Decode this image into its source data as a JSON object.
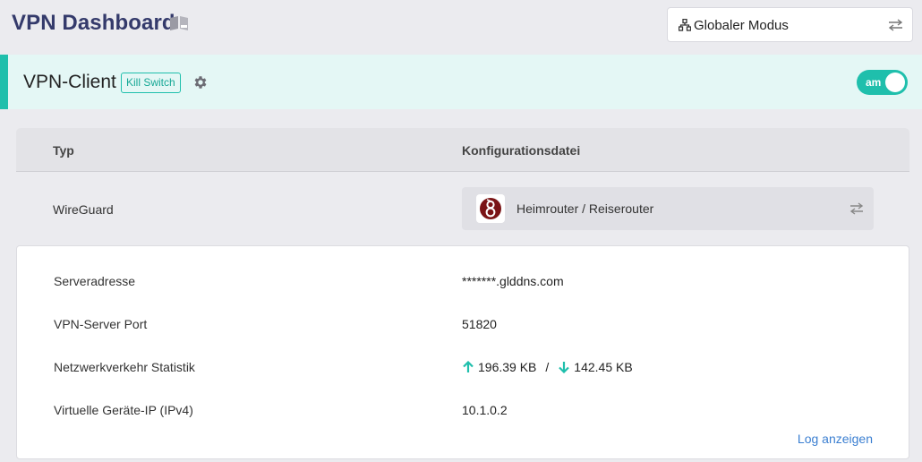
{
  "header": {
    "title": "VPN Dashboard",
    "mode_select": {
      "value": "Globaler Modus"
    }
  },
  "client": {
    "title": "VPN-Client",
    "kill_switch_label": "Kill Switch",
    "toggle_label": "am",
    "toggle_on": true
  },
  "table": {
    "columns": [
      "Typ",
      "Konfigurationsdatei"
    ],
    "type_value": "WireGuard",
    "config_value": "Heimrouter / Reiserouter"
  },
  "details": {
    "server_address_label": "Serveradresse",
    "server_address_value": "*******.glddns.com",
    "port_label": "VPN-Server Port",
    "port_value": "51820",
    "traffic_label": "Netzwerkverkehr Statistik",
    "upload_value": "196.39 KB",
    "traffic_separator": "/",
    "download_value": "142.45 KB",
    "ip_label": "Virtuelle Geräte-IP (IPv4)",
    "ip_value": "10.1.0.2",
    "log_link": "Log anzeigen"
  },
  "colors": {
    "accent": "#1fbfac",
    "title": "#343a6b",
    "link": "#3b7fd1",
    "config_logo": "#7a1416"
  },
  "icons": {
    "title": "book-icon",
    "mode": "tree-icon",
    "swap": "swap-icon",
    "settings": "gear-icon",
    "upload": "arrow-up-icon",
    "download": "arrow-down-icon"
  }
}
